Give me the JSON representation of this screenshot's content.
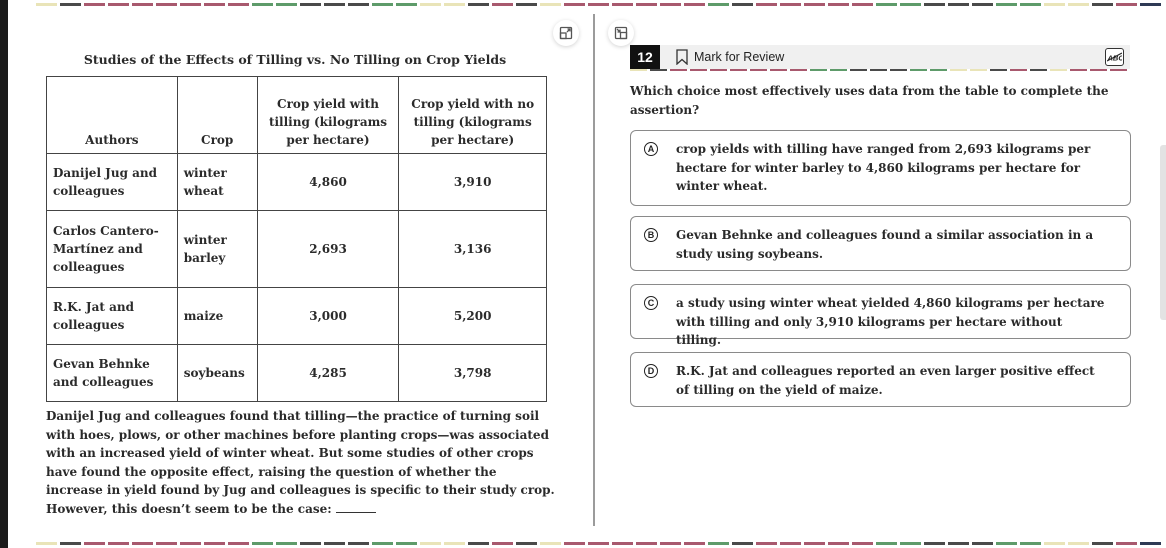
{
  "colors": {
    "dash_palette": [
      "#4a4a4a",
      "#a8596e",
      "#5e9b6a",
      "#e9e4b8",
      "#2f3a55"
    ]
  },
  "toolbar": {
    "expand_left_icon": "expand-icon",
    "collapse_right_icon": "collapse-icon"
  },
  "passage": {
    "table_title": "Studies of the Effects of Tilling vs. No Tilling on Crop Yields",
    "table": {
      "headers": [
        "Authors",
        "Crop",
        "Crop yield with tilling (kilograms per hectare)",
        "Crop yield with no tilling (kilograms per hectare)"
      ],
      "rows": [
        {
          "authors": "Danijel Jug and colleagues",
          "crop": "winter wheat",
          "tilling": "4,860",
          "no_tilling": "3,910"
        },
        {
          "authors": "Carlos Cantero-Martínez and colleagues",
          "crop": "winter barley",
          "tilling": "2,693",
          "no_tilling": "3,136"
        },
        {
          "authors": "R.K. Jat and colleagues",
          "crop": "maize",
          "tilling": "3,000",
          "no_tilling": "5,200"
        },
        {
          "authors": "Gevan Behnke and colleagues",
          "crop": "soybeans",
          "tilling": "4,285",
          "no_tilling": "3,798"
        }
      ]
    },
    "text": "Danijel Jug and colleagues found that tilling—the practice of turning soil with hoes, plows, or other machines before planting crops—was associated with an increased yield of winter wheat. But some studies of other crops have found the opposite effect, raising the question of whether the increase in yield found by Jug and colleagues is specific to their study crop. However, this doesn’t seem to be the case: "
  },
  "question": {
    "number": "12",
    "mark_for_review_label": "Mark for Review",
    "abc_label": "ABC",
    "prompt": "Which choice most effectively uses data from the table to complete the assertion?",
    "choices": [
      {
        "letter": "A",
        "text": "crop yields with tilling have ranged from 2,693 kilograms per hectare for winter barley to 4,860 kilograms per hectare for winter wheat."
      },
      {
        "letter": "B",
        "text": "Gevan Behnke and colleagues found a similar association in a study using soybeans."
      },
      {
        "letter": "C",
        "text": "a study using winter wheat yielded 4,860 kilograms per hectare with tilling and only 3,910 kilograms per hectare without tilling."
      },
      {
        "letter": "D",
        "text": "R.K. Jat and colleagues reported an even larger positive effect of tilling on the yield of maize."
      }
    ]
  }
}
